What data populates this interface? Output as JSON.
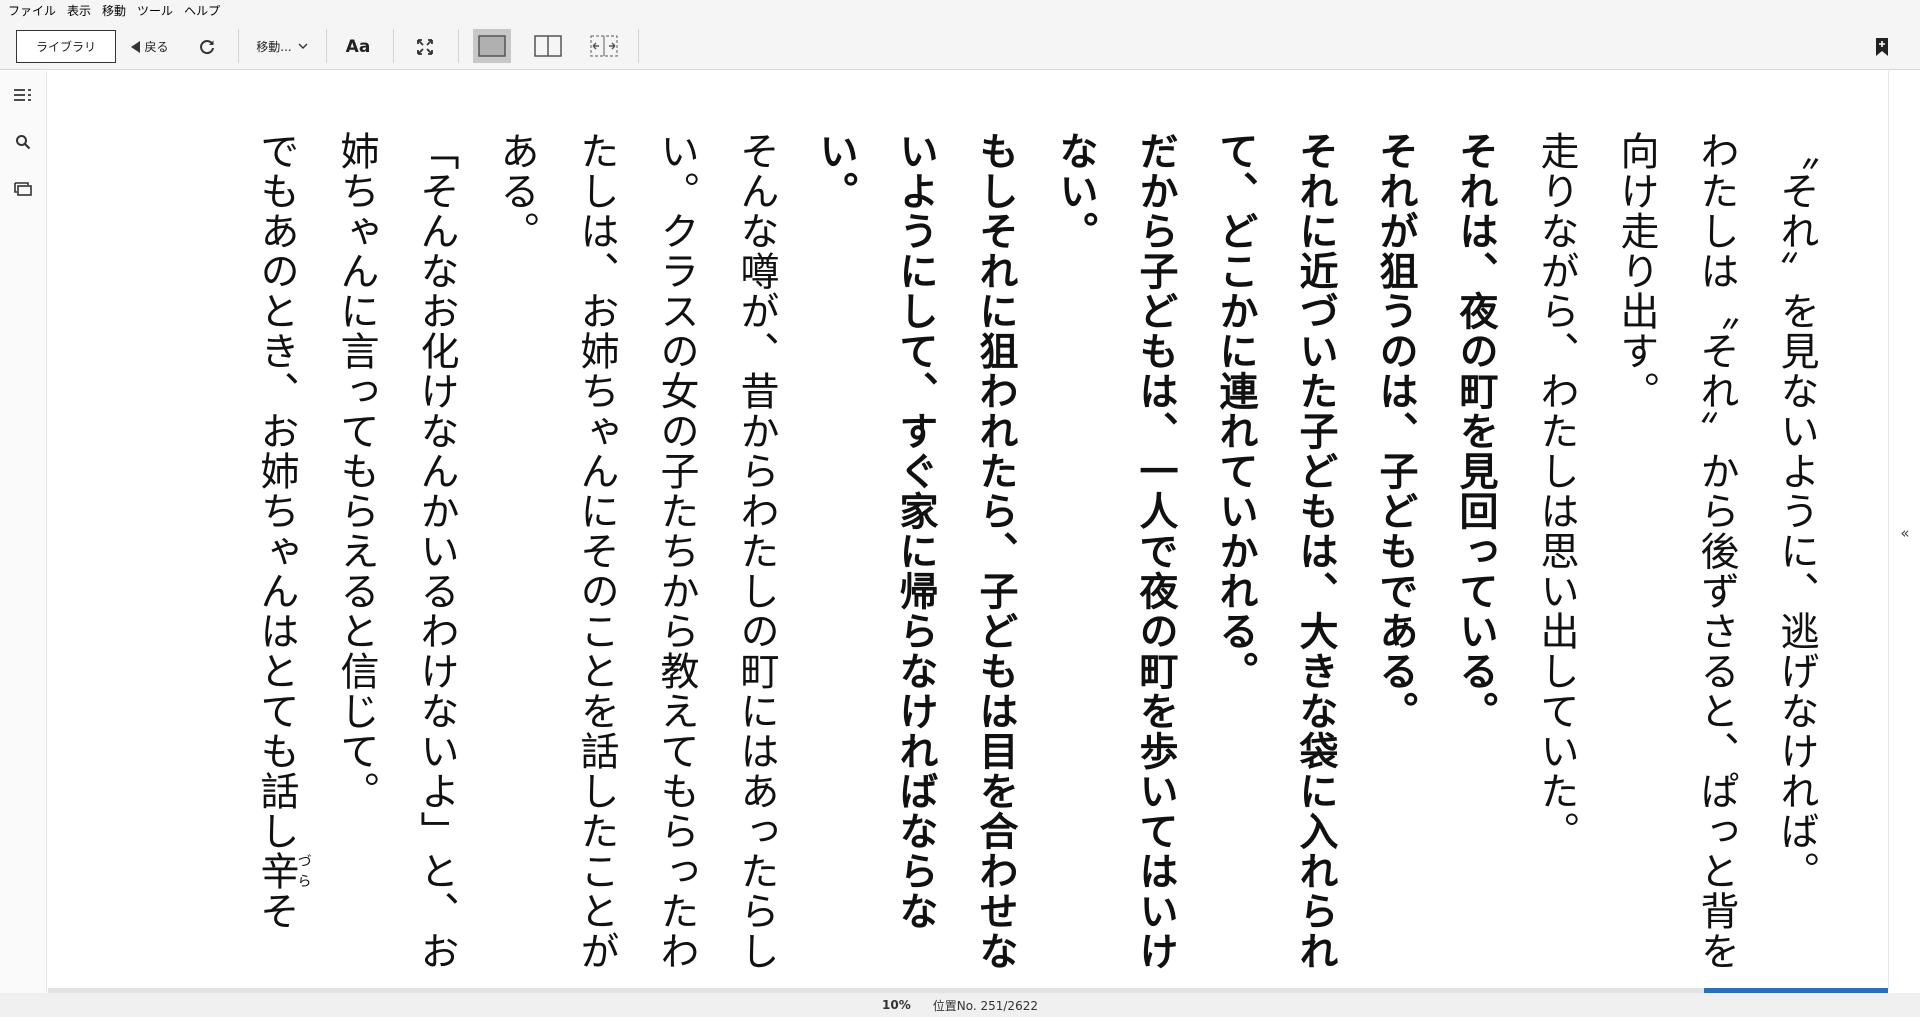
{
  "menu": [
    "ファイル",
    "表示",
    "移動",
    "ツール",
    "ヘルプ"
  ],
  "toolbar": {
    "library_label": "ライブラリ",
    "back_label": "戻る",
    "goto_label": "移動...",
    "font_label": "Aa",
    "icons": {
      "refresh": "refresh-icon",
      "fullscreen": "fullscreen-icon",
      "single_page": "single-page-icon",
      "two_page": "two-page-icon",
      "fit": "fit-width-icon",
      "bookmark": "bookmark-add-icon"
    },
    "active_view": "single-page"
  },
  "sidebar_icons": [
    "toc-icon",
    "search-icon",
    "notes-icon"
  ],
  "book": {
    "paragraphs": [
      {
        "text": "〝それ〟を見ないように、逃げなければ。",
        "bold": false
      },
      {
        "text": "わたしは〝それ〟から後ずさると、ぱっと背を向け走り出す。",
        "bold": false
      },
      {
        "text": "",
        "bold": false
      },
      {
        "text": "走りながら、わたしは思い出していた。",
        "bold": false
      },
      {
        "text": "",
        "bold": false
      },
      {
        "text": "それは、夜の町を見回っている。",
        "bold": true
      },
      {
        "text": "それが狙うのは、子どもである。",
        "bold": true
      },
      {
        "text": "それに近づいた子どもは、大きな袋に入れられて、どこかに連れていかれる。",
        "bold": true
      },
      {
        "text": "だから子どもは、一人で夜の町を歩いてはいけない。",
        "bold": true
      },
      {
        "text": "もしそれに狙われたら、子どもは目を合わせないようにして、すぐ家に帰らなければならない。",
        "bold": true
      },
      {
        "text": "",
        "bold": false
      },
      {
        "text": "そんな噂が、昔からわたしの町にはあったらしい。クラスの女の子たちから教えてもらったわたしは、お姉ちゃんにそのことを話したことがある。",
        "bold": false
      },
      {
        "text": "「そんなお化けなんかいるわけないよ」と、お姉ちゃんに言ってもらえると信じて。",
        "bold": false
      },
      {
        "text": "でもあのとき、お姉ちゃんはとても話し",
        "bold": false,
        "ruby_base": "辛",
        "ruby_text": "づら",
        "tail": "そ"
      }
    ]
  },
  "status": {
    "percent": "10%",
    "location": "位置No. 251/2622",
    "progress_fraction": 0.1
  },
  "colors": {
    "progress": "#2a6fba",
    "chrome_bg": "#f5f5f5"
  }
}
